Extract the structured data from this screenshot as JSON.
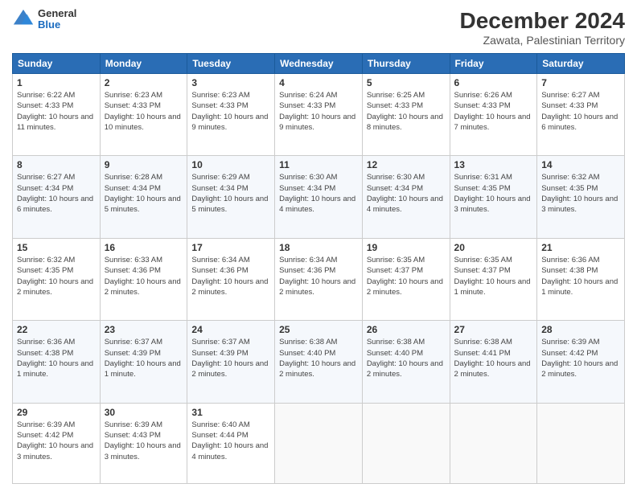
{
  "header": {
    "logo_general": "General",
    "logo_blue": "Blue",
    "title": "December 2024",
    "subtitle": "Zawata, Palestinian Territory"
  },
  "weekdays": [
    "Sunday",
    "Monday",
    "Tuesday",
    "Wednesday",
    "Thursday",
    "Friday",
    "Saturday"
  ],
  "weeks": [
    [
      {
        "day": "1",
        "sunrise": "6:22 AM",
        "sunset": "4:33 PM",
        "daylight": "10 hours and 11 minutes."
      },
      {
        "day": "2",
        "sunrise": "6:23 AM",
        "sunset": "4:33 PM",
        "daylight": "10 hours and 10 minutes."
      },
      {
        "day": "3",
        "sunrise": "6:23 AM",
        "sunset": "4:33 PM",
        "daylight": "10 hours and 9 minutes."
      },
      {
        "day": "4",
        "sunrise": "6:24 AM",
        "sunset": "4:33 PM",
        "daylight": "10 hours and 9 minutes."
      },
      {
        "day": "5",
        "sunrise": "6:25 AM",
        "sunset": "4:33 PM",
        "daylight": "10 hours and 8 minutes."
      },
      {
        "day": "6",
        "sunrise": "6:26 AM",
        "sunset": "4:33 PM",
        "daylight": "10 hours and 7 minutes."
      },
      {
        "day": "7",
        "sunrise": "6:27 AM",
        "sunset": "4:33 PM",
        "daylight": "10 hours and 6 minutes."
      }
    ],
    [
      {
        "day": "8",
        "sunrise": "6:27 AM",
        "sunset": "4:34 PM",
        "daylight": "10 hours and 6 minutes."
      },
      {
        "day": "9",
        "sunrise": "6:28 AM",
        "sunset": "4:34 PM",
        "daylight": "10 hours and 5 minutes."
      },
      {
        "day": "10",
        "sunrise": "6:29 AM",
        "sunset": "4:34 PM",
        "daylight": "10 hours and 5 minutes."
      },
      {
        "day": "11",
        "sunrise": "6:30 AM",
        "sunset": "4:34 PM",
        "daylight": "10 hours and 4 minutes."
      },
      {
        "day": "12",
        "sunrise": "6:30 AM",
        "sunset": "4:34 PM",
        "daylight": "10 hours and 4 minutes."
      },
      {
        "day": "13",
        "sunrise": "6:31 AM",
        "sunset": "4:35 PM",
        "daylight": "10 hours and 3 minutes."
      },
      {
        "day": "14",
        "sunrise": "6:32 AM",
        "sunset": "4:35 PM",
        "daylight": "10 hours and 3 minutes."
      }
    ],
    [
      {
        "day": "15",
        "sunrise": "6:32 AM",
        "sunset": "4:35 PM",
        "daylight": "10 hours and 2 minutes."
      },
      {
        "day": "16",
        "sunrise": "6:33 AM",
        "sunset": "4:36 PM",
        "daylight": "10 hours and 2 minutes."
      },
      {
        "day": "17",
        "sunrise": "6:34 AM",
        "sunset": "4:36 PM",
        "daylight": "10 hours and 2 minutes."
      },
      {
        "day": "18",
        "sunrise": "6:34 AM",
        "sunset": "4:36 PM",
        "daylight": "10 hours and 2 minutes."
      },
      {
        "day": "19",
        "sunrise": "6:35 AM",
        "sunset": "4:37 PM",
        "daylight": "10 hours and 2 minutes."
      },
      {
        "day": "20",
        "sunrise": "6:35 AM",
        "sunset": "4:37 PM",
        "daylight": "10 hours and 1 minute."
      },
      {
        "day": "21",
        "sunrise": "6:36 AM",
        "sunset": "4:38 PM",
        "daylight": "10 hours and 1 minute."
      }
    ],
    [
      {
        "day": "22",
        "sunrise": "6:36 AM",
        "sunset": "4:38 PM",
        "daylight": "10 hours and 1 minute."
      },
      {
        "day": "23",
        "sunrise": "6:37 AM",
        "sunset": "4:39 PM",
        "daylight": "10 hours and 1 minute."
      },
      {
        "day": "24",
        "sunrise": "6:37 AM",
        "sunset": "4:39 PM",
        "daylight": "10 hours and 2 minutes."
      },
      {
        "day": "25",
        "sunrise": "6:38 AM",
        "sunset": "4:40 PM",
        "daylight": "10 hours and 2 minutes."
      },
      {
        "day": "26",
        "sunrise": "6:38 AM",
        "sunset": "4:40 PM",
        "daylight": "10 hours and 2 minutes."
      },
      {
        "day": "27",
        "sunrise": "6:38 AM",
        "sunset": "4:41 PM",
        "daylight": "10 hours and 2 minutes."
      },
      {
        "day": "28",
        "sunrise": "6:39 AM",
        "sunset": "4:42 PM",
        "daylight": "10 hours and 2 minutes."
      }
    ],
    [
      {
        "day": "29",
        "sunrise": "6:39 AM",
        "sunset": "4:42 PM",
        "daylight": "10 hours and 3 minutes."
      },
      {
        "day": "30",
        "sunrise": "6:39 AM",
        "sunset": "4:43 PM",
        "daylight": "10 hours and 3 minutes."
      },
      {
        "day": "31",
        "sunrise": "6:40 AM",
        "sunset": "4:44 PM",
        "daylight": "10 hours and 4 minutes."
      },
      null,
      null,
      null,
      null
    ]
  ]
}
